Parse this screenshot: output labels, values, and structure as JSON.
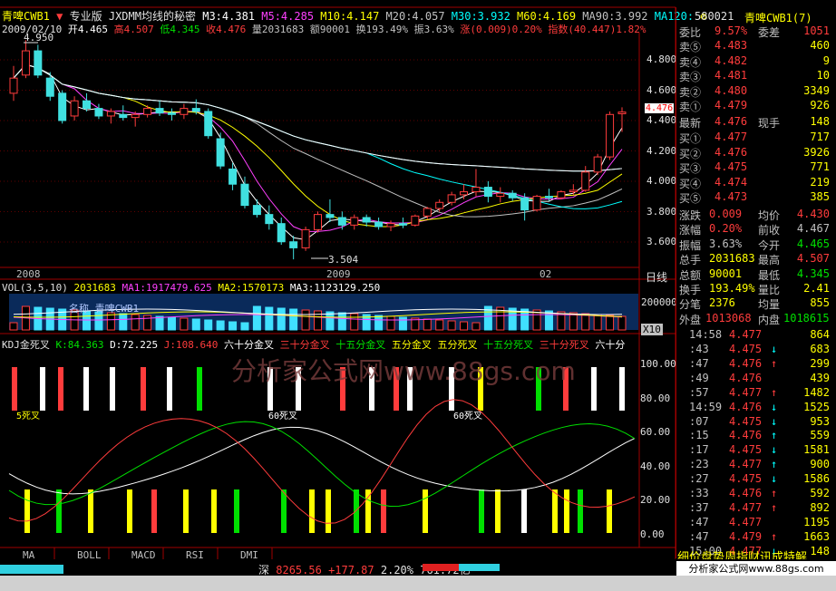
{
  "header": {
    "stock_name": "青啤CWB1",
    "edition": "专业版",
    "indicator_name": "JXDMM均线的秘密",
    "ma_values": [
      {
        "label": "M3:4.381",
        "color": "#ffffff"
      },
      {
        "label": "M5:4.285",
        "color": "#ff40ff"
      },
      {
        "label": "M10:4.147",
        "color": "#ffff00"
      },
      {
        "label": "M20:4.057",
        "color": "#c0c0c0"
      },
      {
        "label": "M30:3.932",
        "color": "#00ffff"
      },
      {
        "label": "M60:4.169",
        "color": "#ffff00"
      },
      {
        "label": "MA90:3.992",
        "color": "#c0c0c0"
      },
      {
        "label": "MA120:",
        "color": "#00ffff"
      }
    ],
    "date_line": "2009/02/10",
    "bar_info": [
      {
        "label": "开4.465",
        "color": "#ffffff"
      },
      {
        "label": "高4.507",
        "color": "#ff3c3c"
      },
      {
        "label": "低4.345",
        "color": "#00e000"
      },
      {
        "label": "收4.476",
        "color": "#ff3c3c"
      },
      {
        "label": "量2031683",
        "color": "#c0c0c0"
      },
      {
        "label": "额90001",
        "color": "#c0c0c0"
      },
      {
        "label": "换193.49%",
        "color": "#c0c0c0"
      },
      {
        "label": "振3.63%",
        "color": "#c0c0c0"
      },
      {
        "label": "涨(0.009)0.20%",
        "color": "#ff3c3c"
      },
      {
        "label": "指数(40.447)1.82%",
        "color": "#ff3c3c"
      }
    ]
  },
  "price_chart": {
    "y_ticks": [
      "4.800",
      "4.600",
      "4.400",
      "4.200",
      "4.000",
      "3.800",
      "3.600"
    ],
    "high_marker": "4.950",
    "low_marker": "3.504",
    "last_price_tag": "4.476",
    "x_labels": [
      "2008",
      "2009",
      "02"
    ],
    "x_right_label": "日线"
  },
  "chart_data": {
    "type": "candlestick",
    "title": "青啤CWB1 日线",
    "ylim": [
      3.5,
      5.0
    ],
    "candles": [
      [
        4.6,
        4.78,
        4.55,
        4.7
      ],
      [
        4.72,
        4.95,
        4.7,
        4.88
      ],
      [
        4.88,
        4.92,
        4.7,
        4.72
      ],
      [
        4.7,
        4.74,
        4.55,
        4.58
      ],
      [
        4.6,
        4.62,
        4.4,
        4.42
      ],
      [
        4.45,
        4.58,
        4.42,
        4.55
      ],
      [
        4.55,
        4.6,
        4.48,
        4.5
      ],
      [
        4.5,
        4.53,
        4.43,
        4.45
      ],
      [
        4.45,
        4.5,
        4.4,
        4.48
      ],
      [
        4.46,
        4.52,
        4.42,
        4.44
      ],
      [
        4.44,
        4.48,
        4.38,
        4.46
      ],
      [
        4.46,
        4.52,
        4.44,
        4.5
      ],
      [
        4.5,
        4.55,
        4.45,
        4.47
      ],
      [
        4.47,
        4.5,
        4.42,
        4.46
      ],
      [
        4.46,
        4.53,
        4.43,
        4.5
      ],
      [
        4.5,
        4.56,
        4.46,
        4.48
      ],
      [
        4.48,
        4.5,
        4.3,
        4.32
      ],
      [
        4.3,
        4.34,
        4.1,
        4.12
      ],
      [
        4.1,
        4.14,
        3.96,
        4.0
      ],
      [
        4.0,
        4.05,
        3.84,
        3.86
      ],
      [
        3.86,
        3.9,
        3.78,
        3.8
      ],
      [
        3.8,
        3.86,
        3.7,
        3.74
      ],
      [
        3.74,
        3.78,
        3.6,
        3.62
      ],
      [
        3.62,
        3.66,
        3.504,
        3.58
      ],
      [
        3.58,
        3.72,
        3.56,
        3.7
      ],
      [
        3.7,
        3.82,
        3.68,
        3.8
      ],
      [
        3.8,
        3.9,
        3.75,
        3.78
      ],
      [
        3.78,
        3.82,
        3.7,
        3.73
      ],
      [
        3.73,
        3.8,
        3.7,
        3.78
      ],
      [
        3.78,
        3.8,
        3.72,
        3.75
      ],
      [
        3.75,
        3.78,
        3.7,
        3.72
      ],
      [
        3.72,
        3.76,
        3.69,
        3.74
      ],
      [
        3.74,
        3.78,
        3.71,
        3.73
      ],
      [
        3.73,
        3.8,
        3.72,
        3.79
      ],
      [
        3.79,
        3.85,
        3.77,
        3.84
      ],
      [
        3.84,
        3.9,
        3.82,
        3.88
      ],
      [
        3.88,
        3.95,
        3.86,
        3.93
      ],
      [
        3.93,
        4.0,
        3.9,
        3.95
      ],
      [
        3.95,
        4.1,
        3.92,
        3.98
      ],
      [
        3.98,
        4.02,
        3.88,
        3.92
      ],
      [
        3.92,
        3.98,
        3.88,
        3.94
      ],
      [
        3.94,
        3.96,
        3.89,
        3.91
      ],
      [
        3.91,
        3.94,
        3.76,
        3.83
      ],
      [
        3.83,
        3.93,
        3.82,
        3.92
      ],
      [
        3.92,
        3.97,
        3.89,
        3.91
      ],
      [
        3.91,
        3.96,
        3.9,
        3.95
      ],
      [
        3.95,
        4.0,
        3.93,
        3.96
      ],
      [
        3.96,
        4.12,
        3.95,
        4.08
      ],
      [
        4.08,
        4.2,
        4.06,
        4.18
      ],
      [
        4.18,
        4.48,
        4.16,
        4.46
      ],
      [
        4.465,
        4.507,
        4.345,
        4.476
      ]
    ]
  },
  "volume_chart": {
    "label": "VOL(3,5,10)",
    "values": [
      {
        "label": "2031683",
        "color": "#ffff00"
      },
      {
        "label": "MA1:1917479.625",
        "color": "#ff40ff"
      },
      {
        "label": "MA2:1570173",
        "color": "#ffff00"
      },
      {
        "label": "MA3:1123129.250",
        "color": "#ffffff"
      }
    ],
    "y_tick": "200000",
    "x10_label": "X10",
    "overlay_text": "名称 青啤CWB1"
  },
  "kdj_chart": {
    "label": "KDJ金死叉",
    "values": [
      {
        "label": "K:84.363",
        "color": "#00e000"
      },
      {
        "label": "D:72.225",
        "color": "#ffffff"
      },
      {
        "label": "J:108.640",
        "color": "#ff3c3c"
      }
    ],
    "signals": [
      {
        "label": "六十分金叉",
        "color": "#ffffff"
      },
      {
        "label": "三十分金叉",
        "color": "#ff3c3c"
      },
      {
        "label": "十五分金叉",
        "color": "#00e000"
      },
      {
        "label": "五分金叉",
        "color": "#ffff00"
      },
      {
        "label": "五分死叉",
        "color": "#ffff00"
      },
      {
        "label": "十五分死叉",
        "color": "#00e000"
      },
      {
        "label": "三十分死叉",
        "color": "#ff3c3c"
      },
      {
        "label": "六十分",
        "color": "#ffffff"
      }
    ],
    "y_ticks": [
      "100.00",
      "80.00",
      "60.00",
      "40.00",
      "20.00",
      "0.00"
    ],
    "watermark": "分析家公式网www.88gs.com"
  },
  "indicator_tabs": [
    "MA",
    "BOLL",
    "MACD",
    "RSI",
    "DMI"
  ],
  "quote_panel": {
    "code": "580021",
    "name": "青啤CWB1(7)",
    "rows_top": [
      {
        "label": "委比",
        "v1": "9.57%",
        "v2": "委差",
        "v3": "1051",
        "c1": "#ff3c3c",
        "c3": "#ff3c3c"
      }
    ],
    "sell": [
      {
        "label": "卖⑤",
        "price": "4.483",
        "vol": "460"
      },
      {
        "label": "卖④",
        "price": "4.482",
        "vol": "9"
      },
      {
        "label": "卖③",
        "price": "4.481",
        "vol": "10"
      },
      {
        "label": "卖②",
        "price": "4.480",
        "vol": "3349"
      },
      {
        "label": "卖①",
        "price": "4.479",
        "vol": "926"
      }
    ],
    "last": {
      "label": "最新",
      "price": "4.476",
      "label2": "现手",
      "vol": "148"
    },
    "buy": [
      {
        "label": "买①",
        "price": "4.477",
        "vol": "717"
      },
      {
        "label": "买②",
        "price": "4.476",
        "vol": "3926"
      },
      {
        "label": "买③",
        "price": "4.475",
        "vol": "771"
      },
      {
        "label": "买④",
        "price": "4.474",
        "vol": "219"
      },
      {
        "label": "买⑤",
        "price": "4.473",
        "vol": "385"
      }
    ],
    "stats": [
      {
        "l1": "涨跌",
        "v1": "0.009",
        "l2": "均价",
        "v2": "4.430",
        "c1": "#ff3c3c",
        "c2": "#ff3c3c"
      },
      {
        "l1": "涨幅",
        "v1": "0.20%",
        "l2": "前收",
        "v2": "4.467",
        "c1": "#ff3c3c",
        "c2": "#c0c0c0"
      },
      {
        "l1": "振幅",
        "v1": "3.63%",
        "l2": "今开",
        "v2": "4.465",
        "c1": "#c0c0c0",
        "c2": "#00e000"
      },
      {
        "l1": "总手",
        "v1": "2031683",
        "l2": "最高",
        "v2": "4.507",
        "c1": "#ffff00",
        "c2": "#ff3c3c"
      },
      {
        "l1": "总额",
        "v1": "90001",
        "l2": "最低",
        "v2": "4.345",
        "c1": "#ffff00",
        "c2": "#00e000"
      },
      {
        "l1": "换手",
        "v1": "193.49%",
        "l2": "量比",
        "v2": "2.41",
        "c1": "#ffff00",
        "c2": "#ffff00"
      },
      {
        "l1": "分笔",
        "v1": "2376",
        "l2": "均量",
        "v2": "855",
        "c1": "#ffff00",
        "c2": "#ffff00"
      }
    ],
    "outer": {
      "l1": "外盘",
      "v1": "1013068",
      "l2": "内盘",
      "v2": "1018615"
    },
    "ticks": [
      {
        "t": "14:58",
        "p": "4.477",
        "a": "",
        "v": "864",
        "c": "#ff3c3c"
      },
      {
        "t": ":43",
        "p": "4.475",
        "a": "↓",
        "v": "683",
        "c": "#00ffff"
      },
      {
        "t": ":47",
        "p": "4.476",
        "a": "↑",
        "v": "299",
        "c": "#ff3c3c"
      },
      {
        "t": ":49",
        "p": "4.476",
        "a": "",
        "v": "439",
        "c": "#ff3c3c"
      },
      {
        "t": ":57",
        "p": "4.477",
        "a": "↑",
        "v": "1482",
        "c": "#ff3c3c"
      },
      {
        "t": "14:59",
        "p": "4.476",
        "a": "↓",
        "v": "1525",
        "c": "#00ffff"
      },
      {
        "t": ":07",
        "p": "4.475",
        "a": "↓",
        "v": "953",
        "c": "#00ffff"
      },
      {
        "t": ":15",
        "p": "4.476",
        "a": "↑",
        "v": "559",
        "c": "#00ffff"
      },
      {
        "t": ":17",
        "p": "4.475",
        "a": "↓",
        "v": "1581",
        "c": "#00ffff"
      },
      {
        "t": ":23",
        "p": "4.477",
        "a": "↑",
        "v": "900",
        "c": "#00ffff"
      },
      {
        "t": ":27",
        "p": "4.475",
        "a": "↓",
        "v": "1586",
        "c": "#00ffff"
      },
      {
        "t": ":33",
        "p": "4.476",
        "a": "↑",
        "v": "592",
        "c": "#ff3c3c"
      },
      {
        "t": ":37",
        "p": "4.477",
        "a": "↑",
        "v": "892",
        "c": "#ff3c3c"
      },
      {
        "t": ":47",
        "p": "4.477",
        "a": "",
        "v": "1195",
        "c": "#ff3c3c"
      },
      {
        "t": ":47",
        "p": "4.479",
        "a": "↑",
        "v": "1663",
        "c": "#ff3c3c"
      },
      {
        "t": "15:00",
        "p": "4.477",
        "a": "↓",
        "v": "148",
        "c": "#00ffff"
      }
    ],
    "bottom_tabs": "细价盘势周指财讯成特解"
  },
  "status_bar": {
    "index_label": "深",
    "index_value": "8265.56",
    "index_change": "+177.87",
    "index_pct": "2.20%",
    "turnover": "761.72亿",
    "site": "分析家公式网www.88gs.com"
  }
}
